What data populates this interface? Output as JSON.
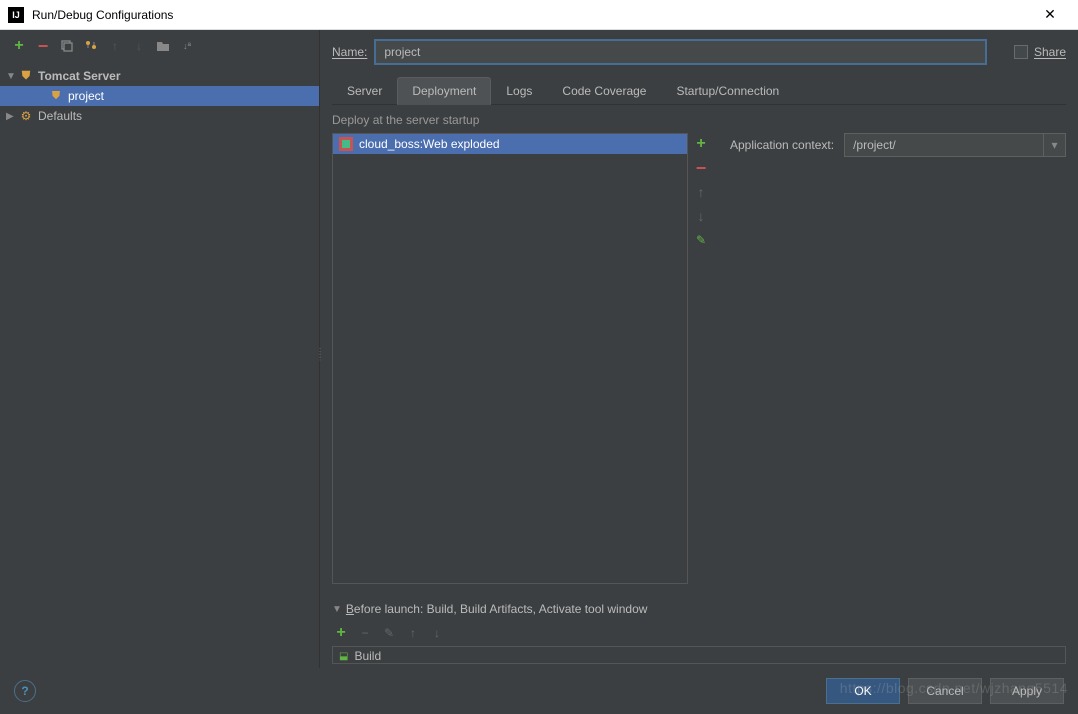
{
  "titlebar": {
    "app_icon_text": "IJ",
    "title": "Run/Debug Configurations"
  },
  "sidebar": {
    "tree": {
      "tomcat_server": "Tomcat Server",
      "project": "project",
      "defaults": "Defaults"
    }
  },
  "right": {
    "name_label": "Name:",
    "name_value": "project",
    "share_label": "Share",
    "tabs": {
      "server": "Server",
      "deployment": "Deployment",
      "logs": "Logs",
      "code_coverage": "Code Coverage",
      "startup": "Startup/Connection"
    },
    "deploy_section_label": "Deploy at the server startup",
    "artifact_item": "cloud_boss:Web exploded",
    "app_context_label": "Application context:",
    "app_context_value": "/project/",
    "before_launch_label": "Before launch: Build, Build Artifacts, Activate tool window",
    "before_launch_item": "Build"
  },
  "footer": {
    "ok": "OK",
    "cancel": "Cancel",
    "apply": "Apply"
  },
  "watermark": "https://blog.csdn.net/wjzhang5514"
}
